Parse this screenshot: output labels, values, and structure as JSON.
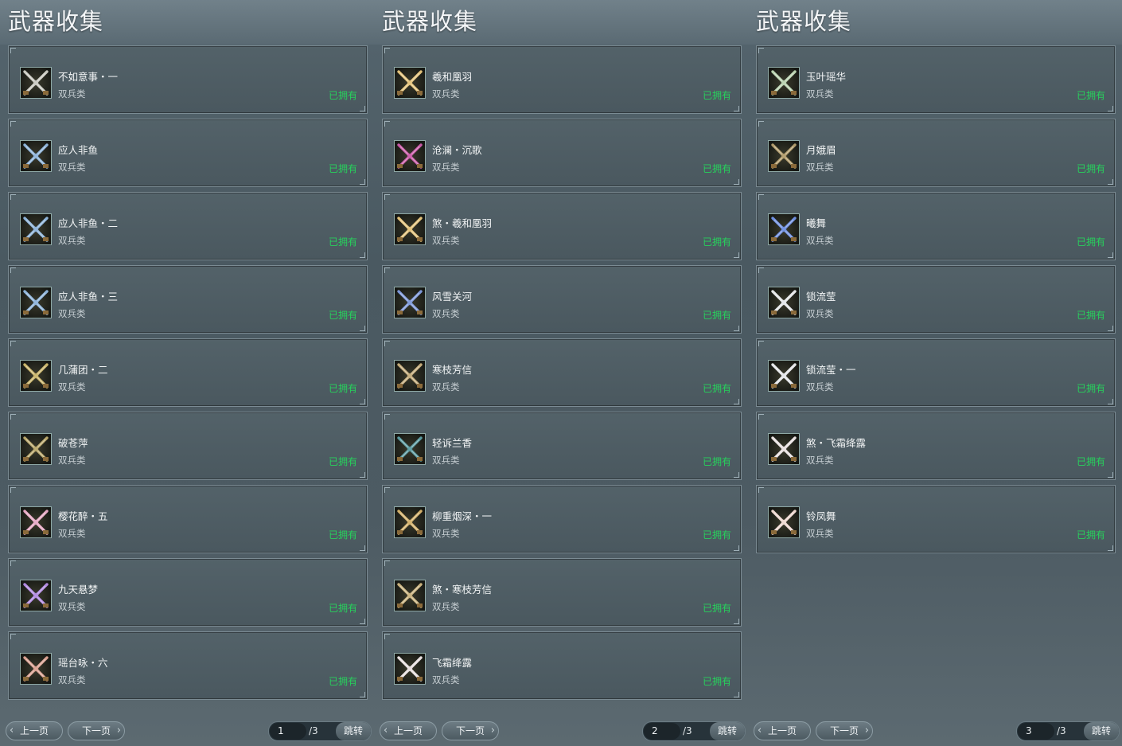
{
  "pages": [
    {
      "title": "武器收集",
      "items": [
        {
          "name": "不如意事・一",
          "type": "双兵类",
          "status": "已拥有",
          "icon": "crossed-silver-blades-icon",
          "color": "#c9c9c0"
        },
        {
          "name": "应人非鱼",
          "type": "双兵类",
          "status": "已拥有",
          "icon": "crossed-blue-cleavers-icon",
          "color": "#8db3d9"
        },
        {
          "name": "应人非鱼・二",
          "type": "双兵类",
          "status": "已拥有",
          "icon": "crossed-blue-cleavers-icon",
          "color": "#8db3d9"
        },
        {
          "name": "应人非鱼・三",
          "type": "双兵类",
          "status": "已拥有",
          "icon": "crossed-blue-cleavers-icon",
          "color": "#8db3d9"
        },
        {
          "name": "几蒲团・二",
          "type": "双兵类",
          "status": "已拥有",
          "icon": "crossed-gold-blades-icon",
          "color": "#c9b46a"
        },
        {
          "name": "破苍萍",
          "type": "双兵类",
          "status": "已拥有",
          "icon": "single-gold-blade-icon",
          "color": "#b8a66a"
        },
        {
          "name": "樱花醉・五",
          "type": "双兵类",
          "status": "已拥有",
          "icon": "crossed-pink-blades-icon",
          "color": "#e6a8c4"
        },
        {
          "name": "九天悬梦",
          "type": "双兵类",
          "status": "已拥有",
          "icon": "crossed-purple-blades-icon",
          "color": "#b18ae0"
        },
        {
          "name": "瑶台咏・六",
          "type": "双兵类",
          "status": "已拥有",
          "icon": "crossed-red-blades-icon",
          "color": "#d9a090"
        }
      ],
      "prev_label": "上一页",
      "next_label": "下一页",
      "page_input": "1",
      "page_total": "/3",
      "jump_label": "跳转"
    },
    {
      "title": "武器收集",
      "items": [
        {
          "name": "羲和凰羽",
          "type": "双兵类",
          "status": "已拥有",
          "icon": "crossed-gold-feather-blades-icon",
          "color": "#e3c27a"
        },
        {
          "name": "沧澜・沉歌",
          "type": "双兵类",
          "status": "已拥有",
          "icon": "crossed-magenta-blades-icon",
          "color": "#c95aa8"
        },
        {
          "name": "煞・羲和凰羽",
          "type": "双兵类",
          "status": "已拥有",
          "icon": "crossed-gold-feather-blades-icon",
          "color": "#e3c27a"
        },
        {
          "name": "风雪关河",
          "type": "双兵类",
          "status": "已拥有",
          "icon": "crossed-blue-blades-icon",
          "color": "#7d97d8"
        },
        {
          "name": "寒枝芳信",
          "type": "双兵类",
          "status": "已拥有",
          "icon": "crossed-bronze-blades-icon",
          "color": "#c3ab7a"
        },
        {
          "name": "轻诉兰香",
          "type": "双兵类",
          "status": "已拥有",
          "icon": "crossed-teal-blades-icon",
          "color": "#5a9aa0"
        },
        {
          "name": "柳重烟深・一",
          "type": "双兵类",
          "status": "已拥有",
          "icon": "crossed-gold-blades-icon",
          "color": "#d2b06a"
        },
        {
          "name": "煞・寒枝芳信",
          "type": "双兵类",
          "status": "已拥有",
          "icon": "crossed-bronze-blades-icon",
          "color": "#c9b27e"
        },
        {
          "name": "飞霜绛露",
          "type": "双兵类",
          "status": "已拥有",
          "icon": "crossed-white-red-blades-icon",
          "color": "#e8e0e0"
        }
      ],
      "prev_label": "上一页",
      "next_label": "下一页",
      "page_input": "2",
      "page_total": "/3",
      "jump_label": "跳转"
    },
    {
      "title": "武器收集",
      "items": [
        {
          "name": "玉叶瑶华",
          "type": "双兵类",
          "status": "已拥有",
          "icon": "crossed-jade-blades-icon",
          "color": "#b9d2b0"
        },
        {
          "name": "月娥眉",
          "type": "双兵类",
          "status": "已拥有",
          "icon": "crossed-dark-gold-blades-icon",
          "color": "#b09a6a"
        },
        {
          "name": "曦舞",
          "type": "双兵类",
          "status": "已拥有",
          "icon": "crossed-blue-blades-icon",
          "color": "#6f8fe0"
        },
        {
          "name": "锁流莹",
          "type": "双兵类",
          "status": "已拥有",
          "icon": "crossed-silver-blades-icon",
          "color": "#e4e6e8"
        },
        {
          "name": "锁流莹・一",
          "type": "双兵类",
          "status": "已拥有",
          "icon": "crossed-silver-blades-icon",
          "color": "#e4e6e8"
        },
        {
          "name": "煞・飞霜绛露",
          "type": "双兵类",
          "status": "已拥有",
          "icon": "crossed-white-red-blades-icon",
          "color": "#e8e0e0"
        },
        {
          "name": "铃凤舞",
          "type": "双兵类",
          "status": "已拥有",
          "icon": "crossed-white-red-blades-icon",
          "color": "#eed8d0"
        }
      ],
      "prev_label": "上一页",
      "next_label": "下一页",
      "page_input": "3",
      "page_total": "/3",
      "jump_label": "跳转"
    }
  ],
  "colors": {
    "owned_green": "#27d15c",
    "title_white": "#f3f5f7"
  }
}
